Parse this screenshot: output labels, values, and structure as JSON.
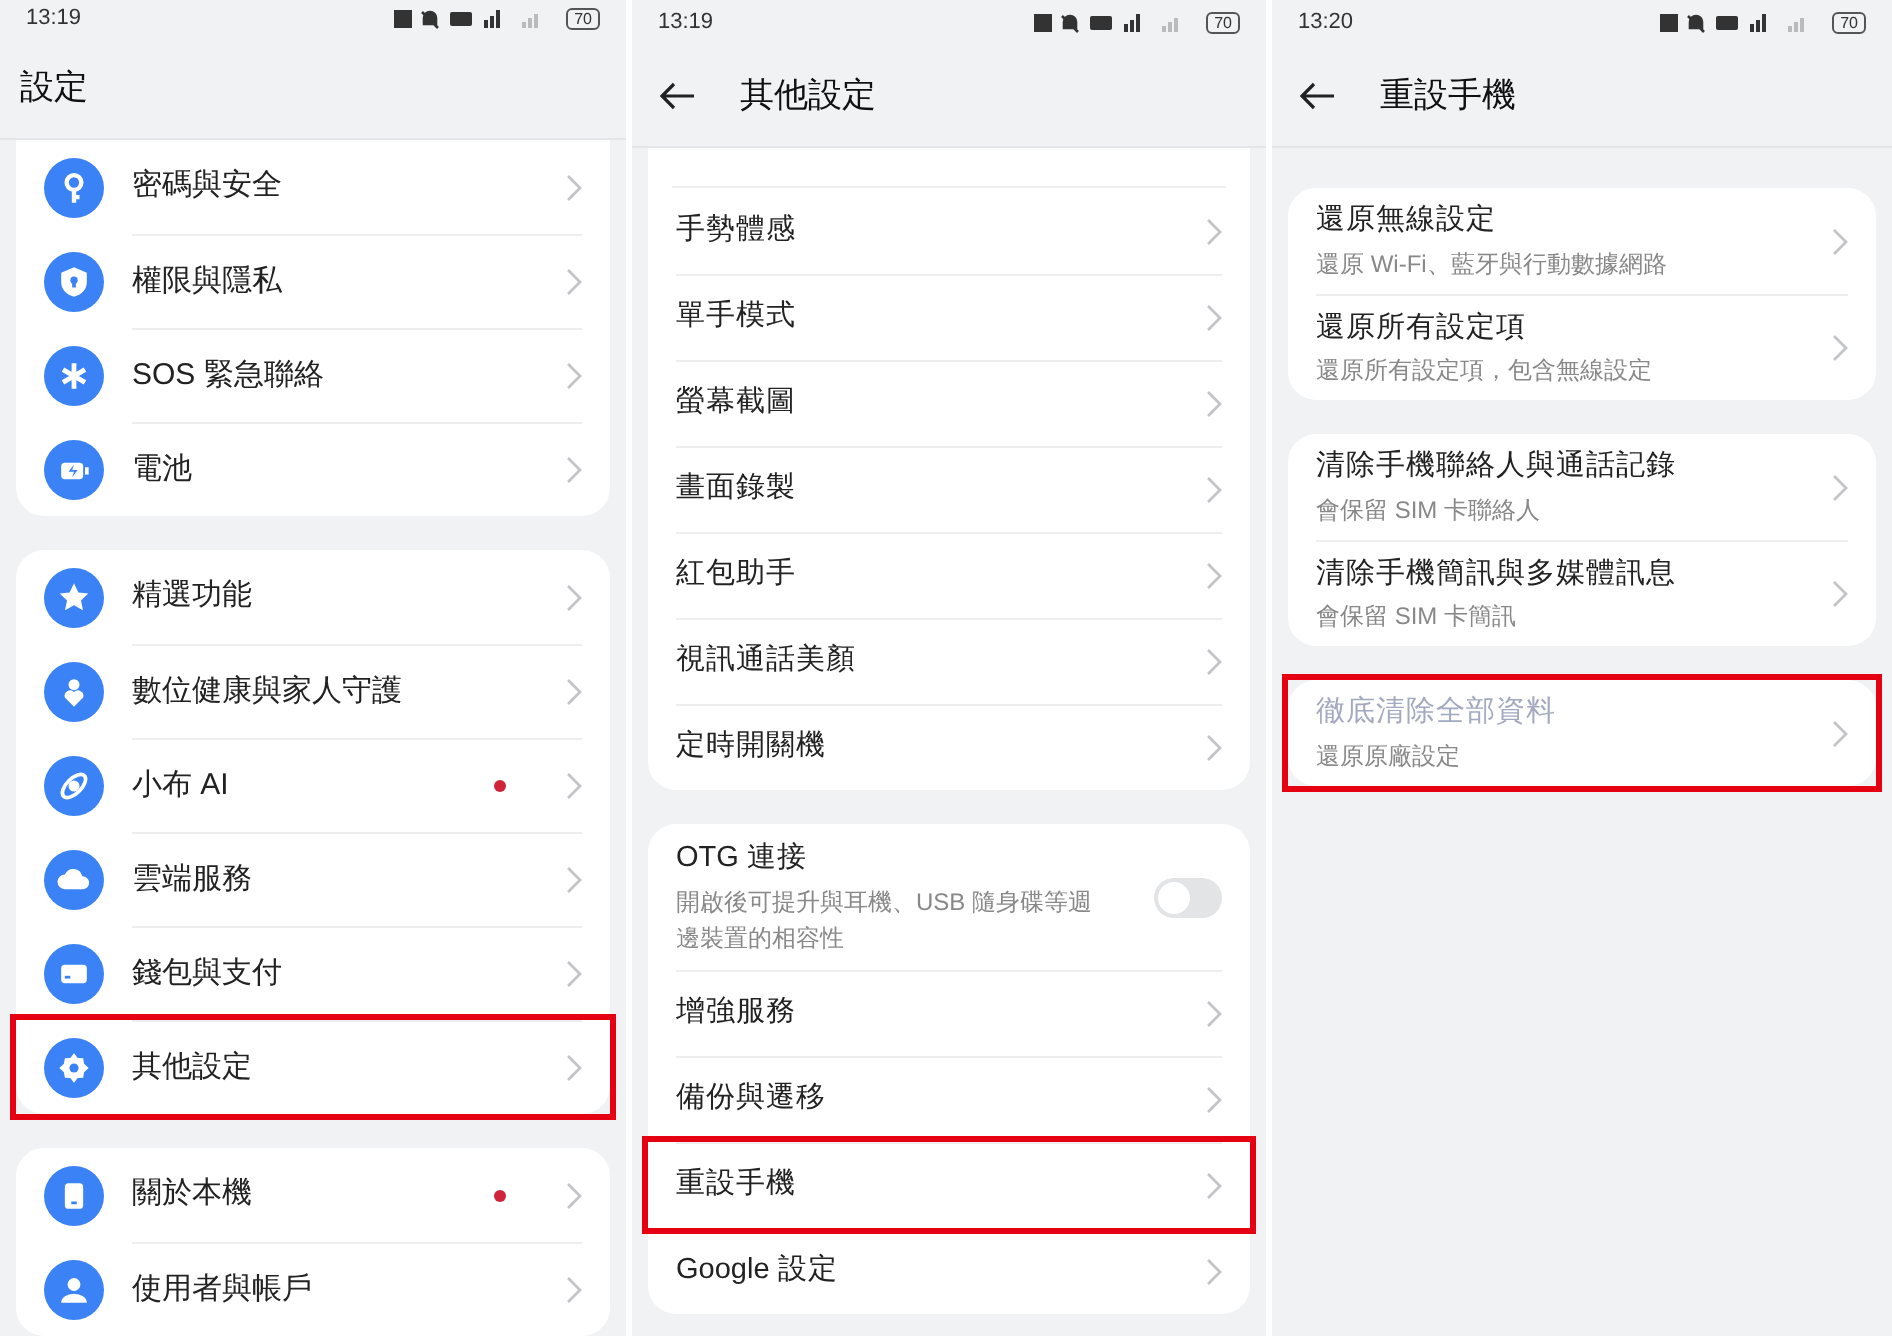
{
  "screens": [
    {
      "status_bar": {
        "time": "13:19",
        "battery": "70"
      },
      "title": "設定",
      "back": false,
      "groups": [
        {
          "cut_top": true,
          "items": [
            {
              "kind": "icon",
              "label": "密碼與安全",
              "badge": false,
              "highlighted": false
            },
            {
              "kind": "icon",
              "label": "權限與隱私",
              "badge": false,
              "highlighted": false
            },
            {
              "kind": "icon",
              "label": "SOS 緊急聯絡",
              "badge": false,
              "highlighted": false
            },
            {
              "kind": "icon",
              "label": "電池",
              "badge": false,
              "highlighted": false
            }
          ]
        },
        {
          "cut_top": false,
          "items": [
            {
              "kind": "icon",
              "label": "精選功能",
              "badge": false,
              "highlighted": false
            },
            {
              "kind": "icon",
              "label": "數位健康與家人守護",
              "badge": false,
              "highlighted": false
            },
            {
              "kind": "icon",
              "label": "小布 AI",
              "badge": true,
              "highlighted": false
            },
            {
              "kind": "icon",
              "label": "雲端服務",
              "badge": false,
              "highlighted": false
            },
            {
              "kind": "icon",
              "label": "錢包與支付",
              "badge": false,
              "highlighted": false
            },
            {
              "kind": "icon",
              "label": "其他設定",
              "badge": false,
              "highlighted": true
            }
          ]
        },
        {
          "cut_top": false,
          "items": [
            {
              "kind": "icon",
              "label": "關於本機",
              "badge": true,
              "highlighted": false
            },
            {
              "kind": "icon",
              "label": "使用者與帳戶",
              "badge": false,
              "highlighted": false
            }
          ]
        }
      ]
    },
    {
      "status_bar": {
        "time": "13:19",
        "battery": "70"
      },
      "title": "其他設定",
      "back": true,
      "groups": [
        {
          "cut_top": true,
          "items": [
            {
              "kind": "plain",
              "label": "手勢體感",
              "highlighted": false
            },
            {
              "kind": "plain",
              "label": "單手模式",
              "highlighted": false
            },
            {
              "kind": "plain",
              "label": "螢幕截圖",
              "highlighted": false
            },
            {
              "kind": "plain",
              "label": "畫面錄製",
              "highlighted": false
            },
            {
              "kind": "plain",
              "label": "紅包助手",
              "highlighted": false
            },
            {
              "kind": "plain",
              "label": "視訊通話美顏",
              "highlighted": false
            },
            {
              "kind": "plain",
              "label": "定時開關機",
              "highlighted": false
            }
          ]
        },
        {
          "cut_top": false,
          "items": [
            {
              "kind": "toggle",
              "label": "OTG 連接",
              "subtitle": "開啟後可提升與耳機、USB 隨身碟等週邊裝置的相容性",
              "on": false,
              "highlighted": false
            },
            {
              "kind": "plain",
              "label": "增強服務",
              "highlighted": false
            },
            {
              "kind": "plain",
              "label": "備份與遷移",
              "highlighted": false
            },
            {
              "kind": "plain",
              "label": "重設手機",
              "highlighted": true
            },
            {
              "kind": "plain",
              "label": "Google 設定",
              "highlighted": false
            }
          ]
        }
      ]
    },
    {
      "status_bar": {
        "time": "13:20",
        "battery": "70"
      },
      "title": "重設手機",
      "back": true,
      "groups": [
        {
          "cut_top": false,
          "items": [
            {
              "kind": "detail",
              "label": "還原無線設定",
              "subtitle": "還原 Wi-Fi、藍牙與行動數據網路",
              "disabled": false,
              "highlighted": false
            },
            {
              "kind": "detail",
              "label": "還原所有設定項",
              "subtitle": "還原所有設定項，包含無線設定",
              "disabled": false,
              "highlighted": false
            }
          ]
        },
        {
          "cut_top": false,
          "items": [
            {
              "kind": "detail",
              "label": "清除手機聯絡人與通話記錄",
              "subtitle": "會保留 SIM 卡聯絡人",
              "disabled": false,
              "highlighted": false
            },
            {
              "kind": "detail",
              "label": "清除手機簡訊與多媒體訊息",
              "subtitle": "會保留 SIM 卡簡訊",
              "disabled": false,
              "highlighted": false
            }
          ]
        },
        {
          "cut_top": false,
          "items": [
            {
              "kind": "detail",
              "label": "徹底清除全部資料",
              "subtitle": "還原原廠設定",
              "disabled": true,
              "highlighted": true
            }
          ]
        }
      ]
    }
  ]
}
